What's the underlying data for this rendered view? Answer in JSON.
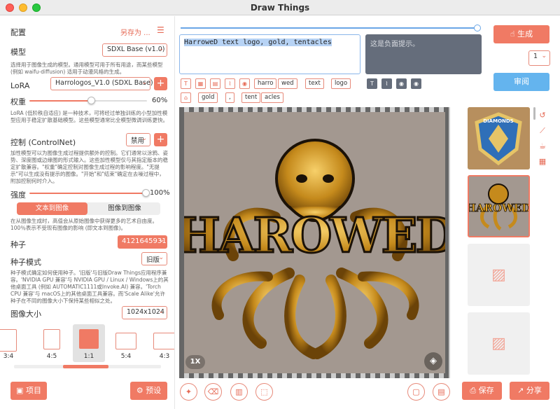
{
  "window": {
    "title": "Draw Things"
  },
  "left": {
    "config_label": "配置",
    "save_as": "另存为 ...",
    "model_label": "模型",
    "model_value": "SDXL Base (v1.0)",
    "model_desc": "选择用于图像生成的模型。通用模型可用于所有用途，而某些模型(例如 waifu-diffusion) 适用于动漫风格的生成。",
    "lora_label": "LoRA",
    "lora_value": "Harrologos_V1.0 (SDXL Base)",
    "weight_label": "权重",
    "weight_value": "60%",
    "weight_fraction": 0.6,
    "lora_desc": "LoRA (低阶秩自适应) 是一种技术，可将经过单独训练的小型加性模型应用于稳定扩散基础模型。这些模型通常比全模型微调训练更快。",
    "control_label": "控制 (ControlNet)",
    "control_value": "禁用",
    "control_desc": "加性模型可以为图像生成过程提供额外的控制。它们通常以涂鸦、姿势、深度图或边缘图的形式输入。这些加性模型仅与其指定版本的稳定扩散兼容。\"权重\"确定控制对图像生成过程的影响程度。\"无提示\"可以生成没有提示的图像。\"开始\"和\"结束\"确定在去噪过程中，附加控制何时介入。",
    "strength_label": "强度",
    "strength_value": "100%",
    "strength_fraction": 1.0,
    "seg_text2img": "文本到图像",
    "seg_img2img": "图像到图像",
    "strength_desc": "在从图像生成时，高值会从原始图像中获得更多的艺术自由度。100％表示不受现有图像的影响 (即文本到图像)。",
    "seed_label": "种子",
    "seed_value": "4121645931",
    "seed_mode_label": "种子模式",
    "seed_mode_value": "旧版",
    "seed_desc": "种子模式确定如何使用种子。'旧版'与旧版Draw Things应用程序兼容。'NVIDIA GPU 兼容'与 NVIDIA GPU / Linux / Windows上的其他桌面工具 (例如 AUTOMATIC1111或Invoke.AI) 兼容。'Torch CPU 兼容'与 macOS上的其他桌面工具兼容。而'Scale Alike'允许种子在不同的图像大小下保持某些相似之处。",
    "image_size_label": "图像大小",
    "image_size_value": "1024x1024",
    "ratios": [
      "3:4",
      "4:5",
      "1:1",
      "5:4",
      "4:3"
    ],
    "project_btn": "项目",
    "preset_btn": "预设"
  },
  "center": {
    "prompt": "HarroweD text logo, gold, tentacles",
    "negative_placeholder": "这是负面提示。",
    "tokens_row1": [
      "harro",
      "wed",
      "text",
      "logo"
    ],
    "tokens_row2": [
      "gold",
      "tent",
      "acles"
    ],
    "token_comma": ",",
    "zoom_label": "1X",
    "logo_text": "HAROWED"
  },
  "right": {
    "generate_btn": "生成",
    "count_value": "1",
    "review_btn": "审阅",
    "save_btn": "保存",
    "share_btn": "分享",
    "badge_text": "DIAMONDS"
  }
}
